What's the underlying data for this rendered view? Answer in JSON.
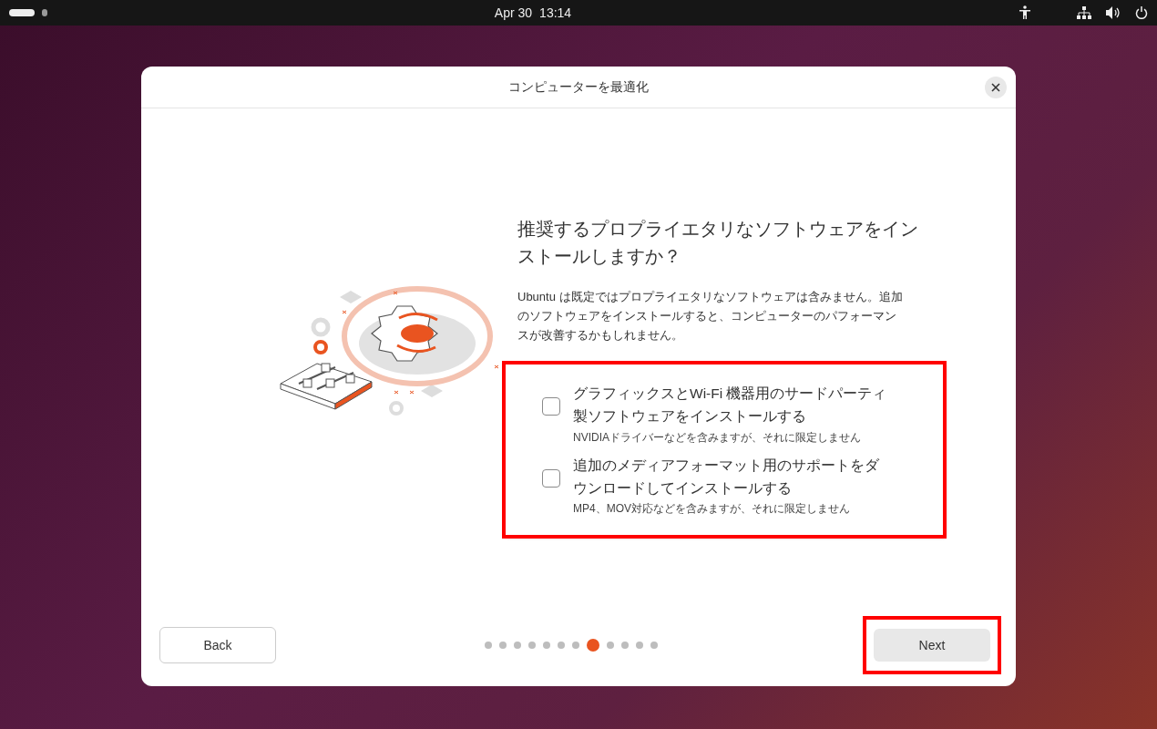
{
  "top_bar": {
    "workspaces": [
      {
        "selected": true
      },
      {
        "selected": false
      }
    ],
    "date": "Apr 30",
    "time": "13:14"
  },
  "dialog": {
    "title": "コンピューターを最適化",
    "heading": "推奨するプロプライエタリなソフトウェアをインストールしますか？",
    "description": "Ubuntu は既定ではプロプライエタリなソフトウェアは含みません。追加のソフトウェアをインストールすると、コンピューターのパフォーマンスが改善するかもしれません。",
    "options_highlighted": true,
    "options": [
      {
        "label": "グラフィックスとWi-Fi 機器用のサードパーティ製ソフトウェアをインストールする",
        "hint": "NVIDIAドライバーなどを含みますが、それに限定しません",
        "checked": false
      },
      {
        "label": "追加のメディアフォーマット用のサポートをダウンロードしてインストールする",
        "hint": "MP4、MOV対応などを含みますが、それに限定しません",
        "checked": false
      }
    ],
    "back_button": "Back",
    "steps": [
      {
        "selected": false
      },
      {
        "selected": false
      },
      {
        "selected": false
      },
      {
        "selected": false
      },
      {
        "selected": false
      },
      {
        "selected": false
      },
      {
        "selected": false
      },
      {
        "selected": true
      },
      {
        "selected": false
      },
      {
        "selected": false
      },
      {
        "selected": false
      },
      {
        "selected": false
      }
    ],
    "next_button": "Next",
    "next_highlighted": true
  }
}
